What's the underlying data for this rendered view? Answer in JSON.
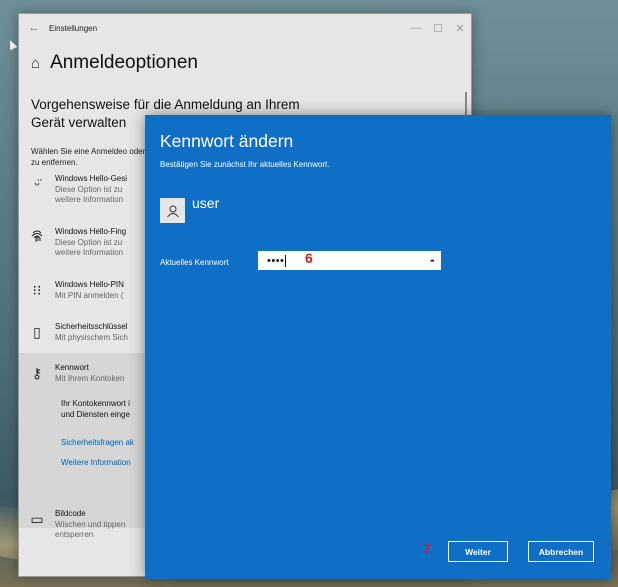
{
  "settings": {
    "window_title": "Einstellungen",
    "page_title": "Anmeldeoptionen",
    "subheading": "Vorgehensweise für die Anmeldung an Ihrem Gerät verwalten",
    "description": "Wählen Sie eine Anmeldeo oder zu entfernen.",
    "options": [
      {
        "icon": "face-icon",
        "title": "Windows Hello-Gesi",
        "sub1": "Diese Option ist zu",
        "sub2": "weitere Information"
      },
      {
        "icon": "fingerprint-icon",
        "title": "Windows Hello-Fing",
        "sub1": "Diese Option ist zu",
        "sub2": "weitere Information"
      },
      {
        "icon": "pin-keypad-icon",
        "title": "Windows Hello-PIN",
        "sub1": "Mit PIN anmelden (",
        "sub2": ""
      },
      {
        "icon": "security-key-icon",
        "title": "Sicherheitsschlüssel",
        "sub1": "Mit physischem Sich",
        "sub2": ""
      },
      {
        "icon": "key-icon",
        "title": "Kennwort",
        "sub1": "Mit Ihrem Kontoken",
        "sub2": ""
      },
      {
        "icon": "picture-icon",
        "title": "Bildcode",
        "sub1": "Wischen und tippen",
        "sub2": "entsperren"
      }
    ],
    "kennwort_expanded": {
      "text1": "Ihr Kontokennwort i",
      "text2": "und Diensten einge",
      "link1": "Sicherheitsfragen ak",
      "link2": "Weitere Information"
    }
  },
  "dialog": {
    "title": "Kennwort ändern",
    "instruction": "Bestätigen Sie zunächst Ihr aktuelles Kennwort.",
    "username": "user",
    "password_label": "Aktuelles Kennwort",
    "password_value": "••••",
    "step_marker_field": "6",
    "step_marker_button": "7",
    "next_button": "Weiter",
    "cancel_button": "Abbrechen"
  }
}
